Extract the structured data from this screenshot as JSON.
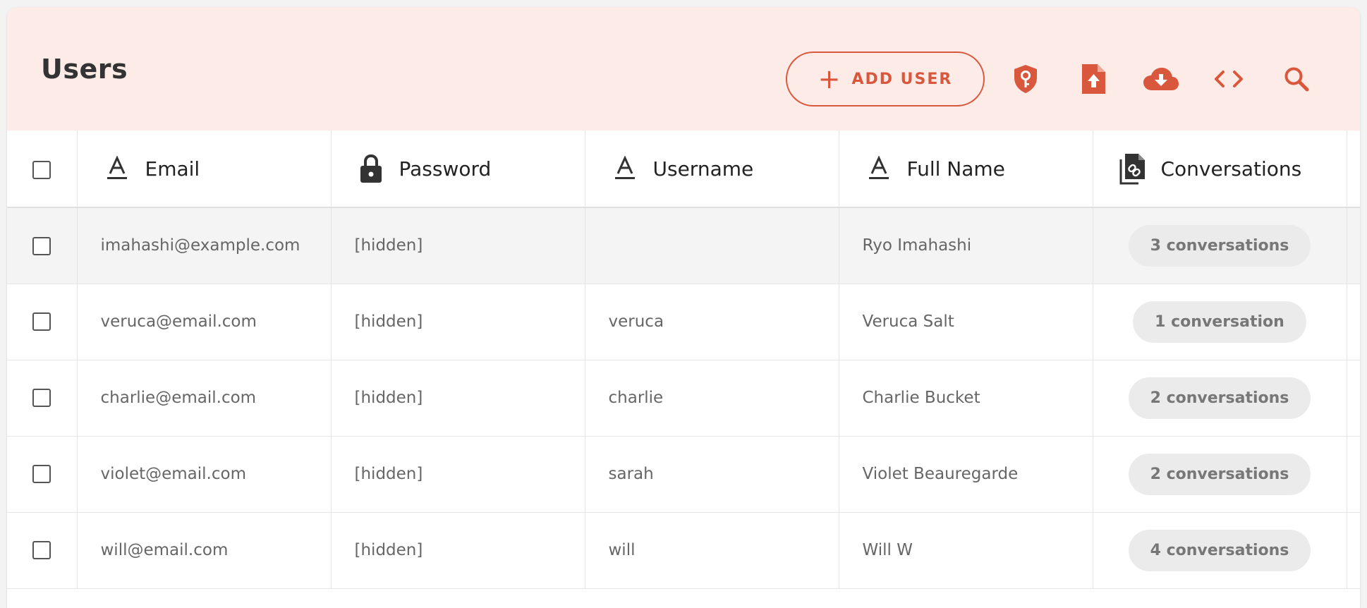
{
  "header": {
    "title": "Users",
    "add_user_label": "ADD USER",
    "actions": [
      {
        "icon": "shield-key-icon"
      },
      {
        "icon": "file-upload-icon"
      },
      {
        "icon": "cloud-download-icon"
      },
      {
        "icon": "code-icon"
      },
      {
        "icon": "search-icon"
      }
    ]
  },
  "table": {
    "columns": [
      {
        "label": "Email",
        "icon": "text-type-icon"
      },
      {
        "label": "Password",
        "icon": "lock-icon"
      },
      {
        "label": "Username",
        "icon": "text-type-icon"
      },
      {
        "label": "Full Name",
        "icon": "text-type-icon"
      },
      {
        "label": "Conversations",
        "icon": "linked-files-icon"
      }
    ],
    "rows": [
      {
        "email": "imahashi@example.com",
        "password": "[hidden]",
        "username": "",
        "full_name": "Ryo Imahashi",
        "conversations": "3 conversations",
        "highlighted": true
      },
      {
        "email": "veruca@email.com",
        "password": "[hidden]",
        "username": "veruca",
        "full_name": "Veruca Salt",
        "conversations": "1 conversation"
      },
      {
        "email": "charlie@email.com",
        "password": "[hidden]",
        "username": "charlie",
        "full_name": "Charlie Bucket",
        "conversations": "2 conversations"
      },
      {
        "email": "violet@email.com",
        "password": "[hidden]",
        "username": "sarah",
        "full_name": "Violet Beauregarde",
        "conversations": "2 conversations"
      },
      {
        "email": "will@email.com",
        "password": "[hidden]",
        "username": "will",
        "full_name": "Will W",
        "conversations": "4 conversations"
      }
    ]
  },
  "colors": {
    "accent": "#d9583d",
    "header_bg": "#fcebe7",
    "chip_bg": "#ebebeb"
  }
}
